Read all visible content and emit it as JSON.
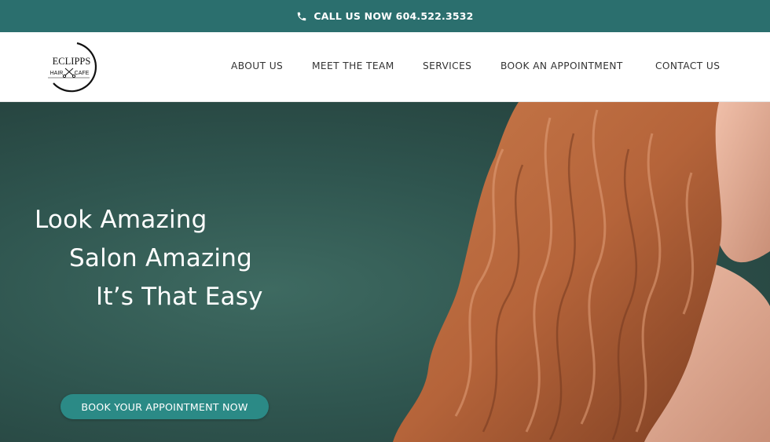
{
  "topbar": {
    "call_text": "CALL US NOW 604.522.3532",
    "phone_icon": "phone-icon",
    "background": "#2b6f6e"
  },
  "logo": {
    "line1": "ECLIPPS",
    "line2_left": "HAIR",
    "line2_right": "CAFE"
  },
  "nav": {
    "items": [
      {
        "label": "ABOUT US"
      },
      {
        "label": "MEET THE TEAM"
      },
      {
        "label": "SERVICES"
      },
      {
        "label": "BOOK AN APPOINTMENT"
      },
      {
        "label": "CONTACT US"
      }
    ]
  },
  "hero": {
    "line1": "Look Amazing",
    "line2": "Salon Amazing",
    "line3": "It’s That Easy",
    "cta_label": "BOOK YOUR APPOINTMENT NOW",
    "cta_color": "#2b8a86",
    "background": "#2f554f",
    "hair_color": "#b5643a"
  }
}
